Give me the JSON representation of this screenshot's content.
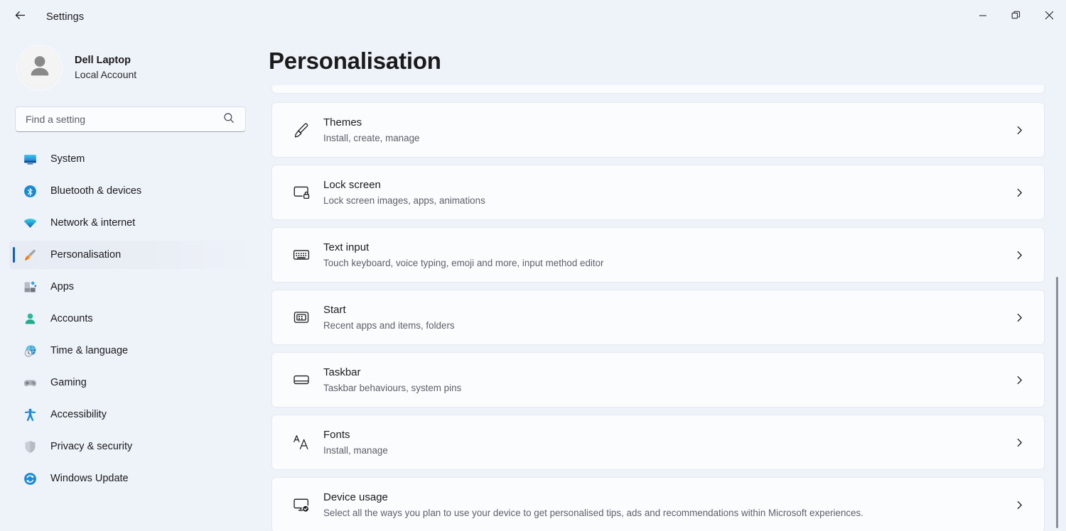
{
  "window": {
    "title": "Settings",
    "back_icon": "back-arrow-icon",
    "controls": {
      "minimize": "minimize-icon",
      "restore": "restore-icon",
      "close": "close-icon"
    }
  },
  "sidebar": {
    "account": {
      "name": "Dell Laptop",
      "type": "Local Account",
      "avatar_icon": "user-avatar-icon"
    },
    "search": {
      "placeholder": "Find a setting",
      "value": "",
      "icon": "search-icon"
    },
    "items": [
      {
        "label": "System",
        "icon": "system-monitor-icon",
        "selected": false
      },
      {
        "label": "Bluetooth & devices",
        "icon": "bluetooth-icon",
        "selected": false
      },
      {
        "label": "Network & internet",
        "icon": "wifi-icon",
        "selected": false
      },
      {
        "label": "Personalisation",
        "icon": "paintbrush-icon",
        "selected": true
      },
      {
        "label": "Apps",
        "icon": "apps-icon",
        "selected": false
      },
      {
        "label": "Accounts",
        "icon": "account-person-icon",
        "selected": false
      },
      {
        "label": "Time & language",
        "icon": "clock-globe-icon",
        "selected": false
      },
      {
        "label": "Gaming",
        "icon": "gamepad-icon",
        "selected": false
      },
      {
        "label": "Accessibility",
        "icon": "accessibility-icon",
        "selected": false
      },
      {
        "label": "Privacy & security",
        "icon": "shield-icon",
        "selected": false
      },
      {
        "label": "Windows Update",
        "icon": "update-refresh-icon",
        "selected": false
      }
    ]
  },
  "main": {
    "page_title": "Personalisation",
    "cards": [
      {
        "title": "Themes",
        "subtitle": "Install, create, manage",
        "icon": "paintbrush-outline-icon",
        "chevron": "chevron-right-icon"
      },
      {
        "title": "Lock screen",
        "subtitle": "Lock screen images, apps, animations",
        "icon": "lock-screen-icon",
        "chevron": "chevron-right-icon"
      },
      {
        "title": "Text input",
        "subtitle": "Touch keyboard, voice typing, emoji and more, input method editor",
        "icon": "keyboard-icon",
        "chevron": "chevron-right-icon"
      },
      {
        "title": "Start",
        "subtitle": "Recent apps and items, folders",
        "icon": "start-menu-icon",
        "chevron": "chevron-right-icon"
      },
      {
        "title": "Taskbar",
        "subtitle": "Taskbar behaviours, system pins",
        "icon": "taskbar-icon",
        "chevron": "chevron-right-icon"
      },
      {
        "title": "Fonts",
        "subtitle": "Install, manage",
        "icon": "fonts-aa-icon",
        "chevron": "chevron-right-icon"
      },
      {
        "title": "Device usage",
        "subtitle": "Select all the ways you plan to use your device to get personalised tips, ads and recommendations within Microsoft experiences.",
        "icon": "device-usage-icon",
        "chevron": "chevron-right-icon"
      }
    ]
  },
  "colors": {
    "background": "#eef2f9",
    "card": "#fbfcfe",
    "accent": "#0a5fc2",
    "text_primary": "#1b1b1b",
    "text_secondary": "#5d6069",
    "scrollbar": "#8a8f98"
  }
}
